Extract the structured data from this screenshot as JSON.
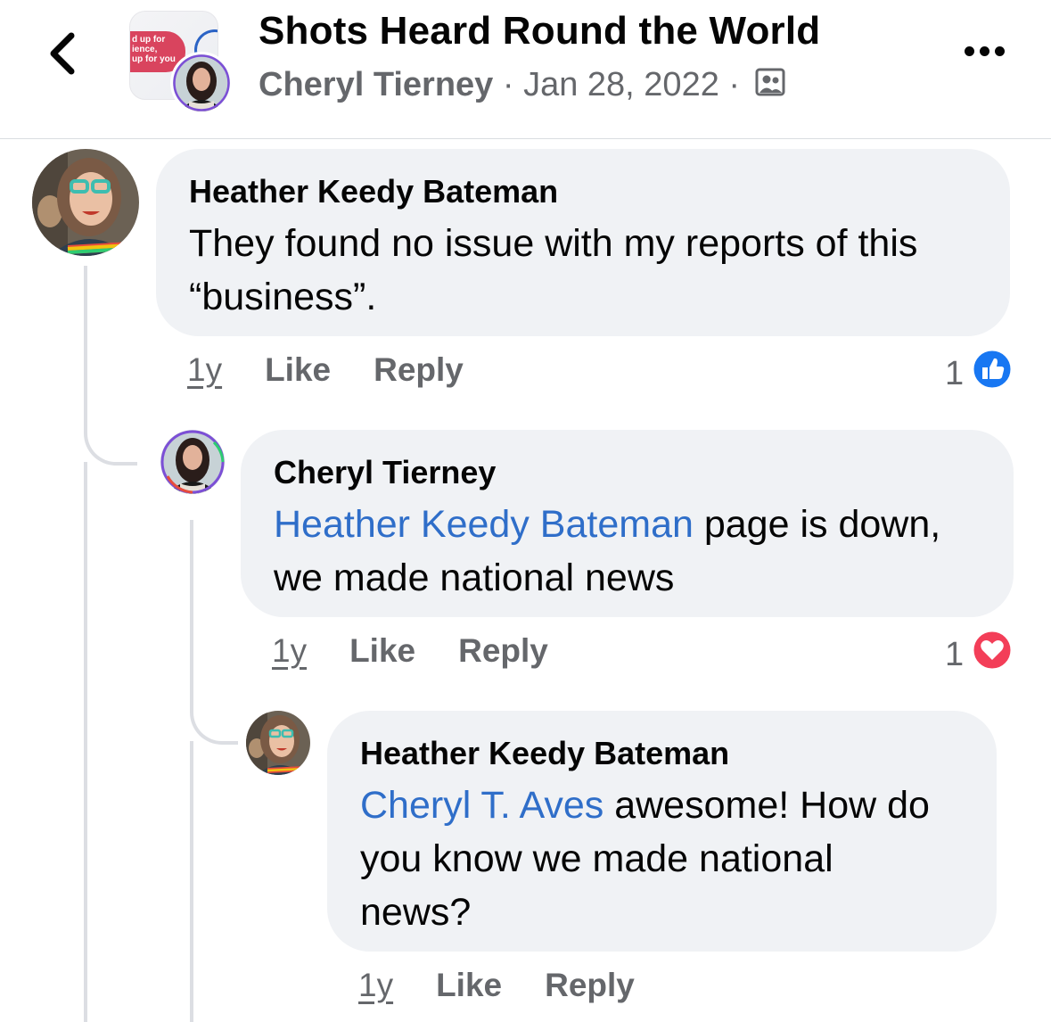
{
  "header": {
    "group_thumb_text_1": "d up for",
    "group_thumb_text_2": "ience,",
    "group_thumb_text_3": "up for you",
    "title": "Shots Heard Round the World",
    "author": "Cheryl Tierney",
    "separator": "·",
    "date": "Jan 28, 2022",
    "audience_icon": "group-audience-icon"
  },
  "comments": [
    {
      "author": "Heather Keedy Bateman",
      "body_line_1": "They found no issue with my reports of this",
      "body_line_2": "“business”.",
      "time": "1y",
      "like": "Like",
      "reply": "Reply",
      "reaction_count": "1",
      "reaction_icon": "like-reaction-icon",
      "reaction_color": "#1877f2"
    },
    {
      "author": "Cheryl Tierney",
      "mention": "Heather Keedy Bateman",
      "body_rest_1": " page is down,",
      "body_line_2": "we made national news",
      "time": "1y",
      "like": "Like",
      "reply": "Reply",
      "reaction_count": "1",
      "reaction_icon": "love-reaction-icon",
      "reaction_color": "#f33e58"
    },
    {
      "author": "Heather Keedy Bateman",
      "mention": "Cheryl T. Aves",
      "body_rest_1": " awesome! How do",
      "body_line_2": "you know we made national",
      "body_line_3": "news?",
      "time": "1y",
      "like": "Like",
      "reply": "Reply"
    }
  ]
}
